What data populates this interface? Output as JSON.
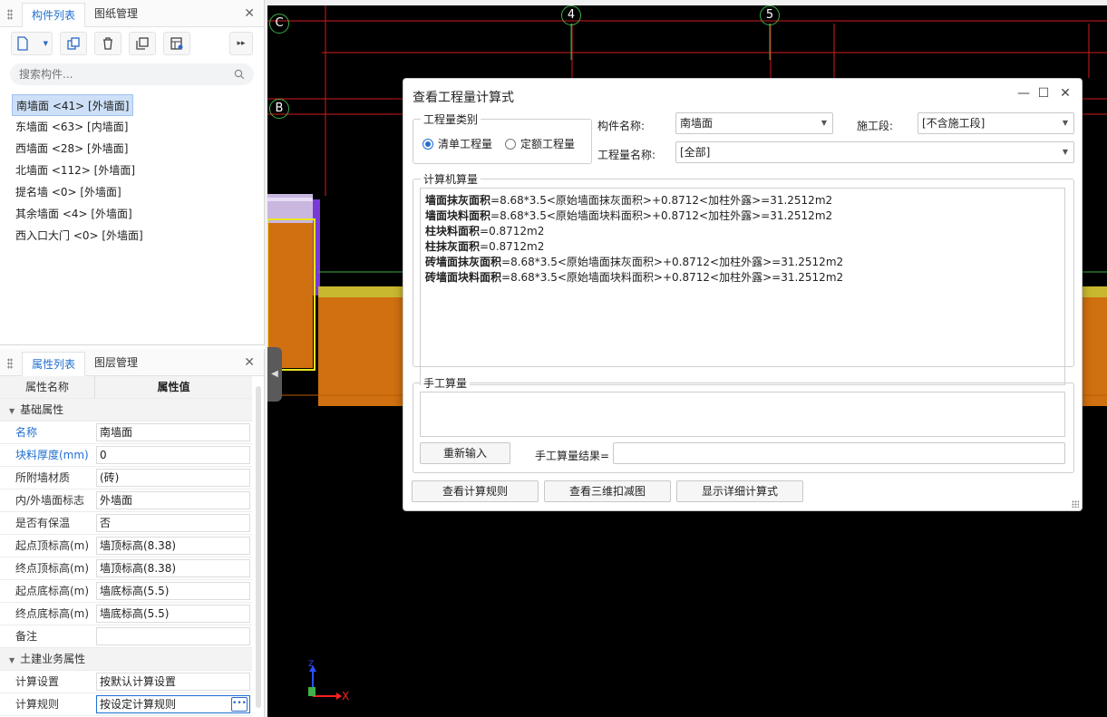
{
  "component_panel": {
    "tabs": [
      "构件列表",
      "图纸管理"
    ],
    "search_placeholder": "搜索构件...",
    "items": [
      "南墙面 <41> [外墙面]",
      "东墙面 <63> [内墙面]",
      "西墙面 <28> [外墙面]",
      "北墙面 <112> [外墙面]",
      "提名墙 <0> [外墙面]",
      "其余墙面 <4> [外墙面]",
      "西入口大门 <0> [外墙面]"
    ],
    "selected_index": 0
  },
  "property_panel": {
    "tabs": [
      "属性列表",
      "图层管理"
    ],
    "col_name": "属性名称",
    "col_value": "属性值",
    "group1": "基础属性",
    "rows": [
      {
        "name": "名称",
        "value": "南墙面"
      },
      {
        "name": "块料厚度(mm)",
        "value": "0"
      },
      {
        "name": "所附墙材质",
        "value": "(砖)"
      },
      {
        "name": "内/外墙面标志",
        "value": "外墙面"
      },
      {
        "name": "是否有保温",
        "value": "否"
      },
      {
        "name": "起点顶标高(m)",
        "value": "墙顶标高(8.38)"
      },
      {
        "name": "终点顶标高(m)",
        "value": "墙顶标高(8.38)"
      },
      {
        "name": "起点底标高(m)",
        "value": "墙底标高(5.5)"
      },
      {
        "name": "终点底标高(m)",
        "value": "墙底标高(5.5)"
      },
      {
        "name": "备注",
        "value": ""
      }
    ],
    "group2": "土建业务属性",
    "rows2": [
      {
        "name": "计算设置",
        "value": "按默认计算设置"
      },
      {
        "name": "计算规则",
        "value": "按设定计算规则"
      }
    ]
  },
  "cad": {
    "axis_labels": [
      "C",
      "B",
      "4",
      "5"
    ],
    "coord_x": "X",
    "coord_z": "Z"
  },
  "dialog": {
    "title": "查看工程量计算式",
    "qty_type_legend": "工程量类别",
    "radio1": "清单工程量",
    "radio2": "定额工程量",
    "component_name_label": "构件名称:",
    "component_name_value": "南墙面",
    "stage_label": "施工段:",
    "stage_value": "[不含施工段]",
    "qty_name_label": "工程量名称:",
    "qty_name_value": "[全部]",
    "computer_legend": "计算机算量",
    "calc_lines": [
      {
        "key": "墙面抹灰面积",
        "formula": "=8.68*3.5<原始墙面抹灰面积>+0.8712<加柱外露>=31.2512m2"
      },
      {
        "key": "墙面块料面积",
        "formula": "=8.68*3.5<原始墙面块料面积>+0.8712<加柱外露>=31.2512m2"
      },
      {
        "key": "柱块料面积",
        "formula": "=0.8712m2"
      },
      {
        "key": "柱抹灰面积",
        "formula": "=0.8712m2"
      },
      {
        "key": "砖墙面抹灰面积",
        "formula": "=8.68*3.5<原始墙面抹灰面积>+0.8712<加柱外露>=31.2512m2"
      },
      {
        "key": "砖墙面块料面积",
        "formula": "=8.68*3.5<原始墙面块料面积>+0.8712<加柱外露>=31.2512m2"
      }
    ],
    "manual_legend": "手工算量",
    "reenter_button": "重新输入",
    "manual_result_label": "手工算量结果=",
    "btn_rules": "查看计算规则",
    "btn_3d": "查看三维扣减图",
    "btn_detail": "显示详细计算式"
  }
}
